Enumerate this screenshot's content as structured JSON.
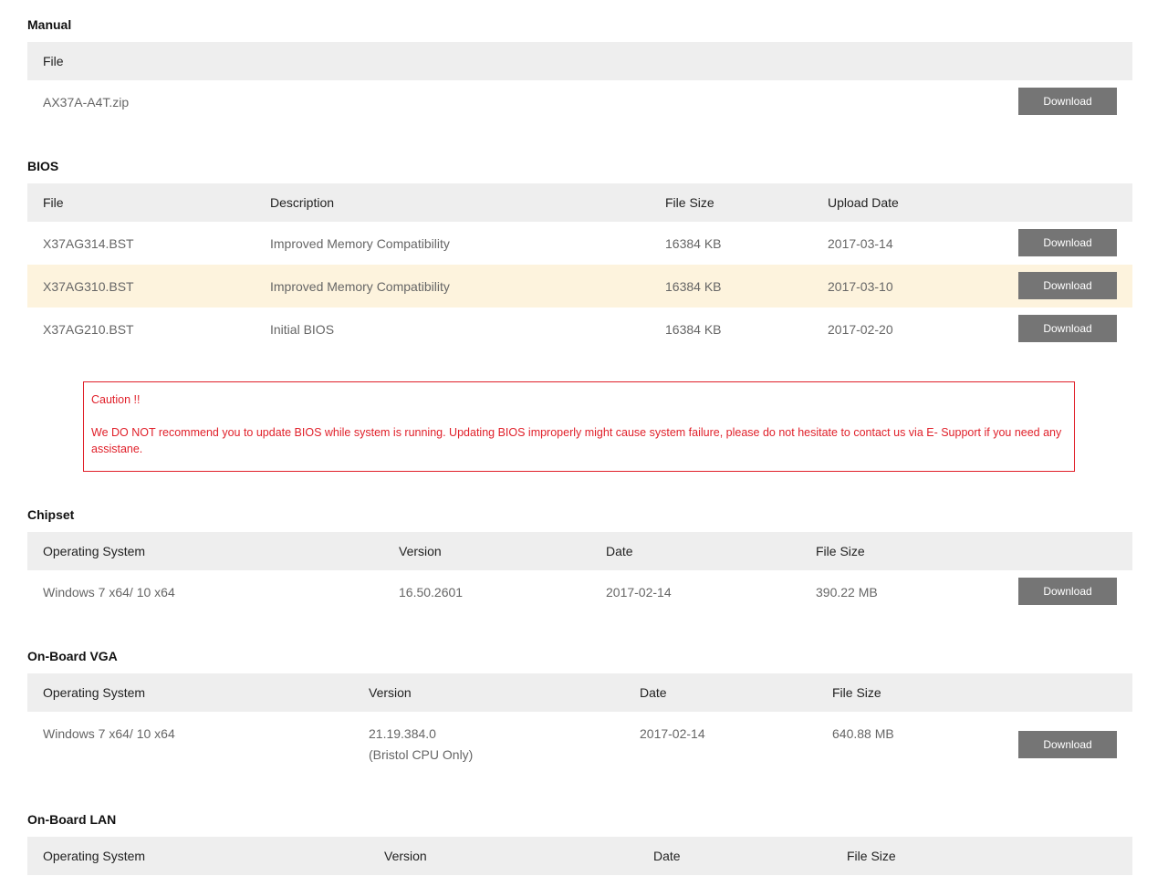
{
  "sections": {
    "manual": {
      "title": "Manual",
      "headers": [
        "File"
      ],
      "rows": [
        {
          "file": "AX37A-A4T.zip",
          "action": "Download"
        }
      ]
    },
    "bios": {
      "title": "BIOS",
      "headers": [
        "File",
        "Description",
        "File Size",
        "Upload Date"
      ],
      "rows": [
        {
          "file": "X37AG314.BST",
          "description": "Improved Memory Compatibility",
          "size": "16384 KB",
          "date": "2017-03-14",
          "action": "Download"
        },
        {
          "file": "X37AG310.BST",
          "description": "Improved Memory Compatibility",
          "size": "16384 KB",
          "date": "2017-03-10",
          "action": "Download"
        },
        {
          "file": "X37AG210.BST",
          "description": "Initial BIOS",
          "size": "16384 KB",
          "date": "2017-02-20",
          "action": "Download"
        }
      ]
    },
    "caution": {
      "title": "Caution !!",
      "text": "We DO NOT recommend you to update BIOS while system is running. Updating BIOS improperly might cause system failure, please do not hesitate to contact us via E- Support if you need any assistane."
    },
    "chipset": {
      "title": "Chipset",
      "headers": [
        "Operating System",
        "Version",
        "Date",
        "File Size"
      ],
      "rows": [
        {
          "os": "Windows 7 x64/ 10 x64",
          "version": "16.50.2601",
          "date": "2017-02-14",
          "size": "390.22 MB",
          "action": "Download"
        }
      ]
    },
    "vga": {
      "title": "On-Board VGA",
      "headers": [
        "Operating System",
        "Version",
        "Date",
        "File Size"
      ],
      "rows": [
        {
          "os": "Windows 7 x64/ 10 x64",
          "version": "21.19.384.0",
          "version_note": "(Bristol CPU Only)",
          "date": "2017-02-14",
          "size": "640.88 MB",
          "action": "Download"
        }
      ]
    },
    "lan": {
      "title": "On-Board LAN",
      "headers": [
        "Operating System",
        "Version",
        "Date",
        "File Size"
      ]
    }
  }
}
